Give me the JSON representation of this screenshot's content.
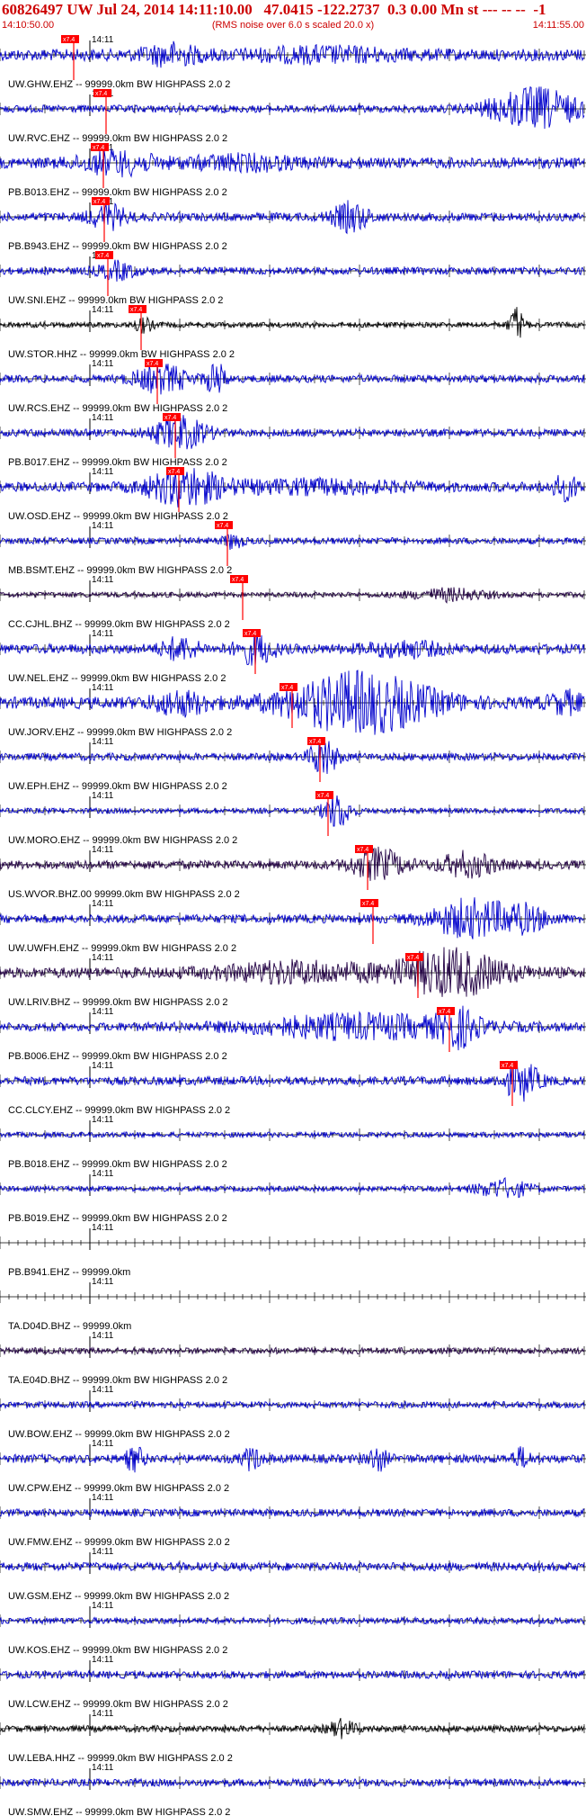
{
  "header": {
    "title": "60826497 UW Jul 24, 2014 14:11:10.00   47.0415 -122.2737  0.3 0.00 Mn st --- -- --  -1",
    "start_time": "14:10:50.00",
    "note": "(RMS noise over 6.0 s scaled 20.0 x)",
    "end_time": "14:11:55.00"
  },
  "colors": {
    "header_text": "#cc0000",
    "trace_blue": "#0000cc",
    "trace_black": "#000000",
    "trace_dark": "#220044",
    "pick": "#ff0000",
    "axis": "#000000"
  },
  "chart_data": {
    "type": "seismogram",
    "time_range_s": [
      0,
      65
    ],
    "tick_label": "14:11",
    "pick_label": "x7.4",
    "traces": [
      {
        "label": "UW.GHW.EHZ -- 99999.0km BW  HIGHPASS  2.0  2",
        "color": "#0000cc",
        "pick_s": 8.2,
        "amp": 0.55,
        "bursts": [
          [
            19,
            3,
            0.8
          ],
          [
            36,
            8,
            0.45
          ]
        ]
      },
      {
        "label": "UW.RVC.EHZ -- 99999.0km BW  HIGHPASS  2.0  2",
        "color": "#0000cc",
        "pick_s": 11.8,
        "amp": 0.35,
        "bursts": [
          [
            59.5,
            5,
            1.8
          ]
        ]
      },
      {
        "label": "PB.B013.EHZ -- 99999.0km BW  HIGHPASS  2.0  2",
        "color": "#0000cc",
        "pick_s": 11.5,
        "amp": 0.5,
        "bursts": [
          [
            13,
            4,
            0.9
          ],
          [
            27,
            6,
            0.5
          ]
        ]
      },
      {
        "label": "PB.B943.EHZ -- 99999.0km BW  HIGHPASS  2.0  2",
        "color": "#0000cc",
        "pick_s": 11.6,
        "amp": 0.4,
        "bursts": [
          [
            12,
            2,
            1.0
          ],
          [
            39,
            2,
            1.2
          ]
        ]
      },
      {
        "label": "UW.SNI.EHZ -- 99999.0km BW  HIGHPASS  2.0  2",
        "color": "#0000cc",
        "pick_s": 12.0,
        "amp": 0.35,
        "bursts": [
          [
            13,
            2,
            0.7
          ]
        ]
      },
      {
        "label": "UW.STOR.HHZ -- 99999.0km BW  HIGHPASS  2.0  2",
        "color": "#000000",
        "pick_s": 15.7,
        "amp": 0.25,
        "bursts": [
          [
            16,
            1,
            0.6
          ],
          [
            57.5,
            0.8,
            1.6
          ]
        ]
      },
      {
        "label": "UW.RCS.EHZ -- 99999.0km BW  HIGHPASS  2.0  2",
        "color": "#0000cc",
        "pick_s": 17.5,
        "amp": 0.35,
        "bursts": [
          [
            18,
            3,
            1.2
          ],
          [
            24,
            1,
            1.5
          ]
        ]
      },
      {
        "label": "PB.B017.EHZ -- 99999.0km BW  HIGHPASS  2.0  2",
        "color": "#0000cc",
        "pick_s": 19.5,
        "amp": 0.35,
        "bursts": [
          [
            20,
            3,
            1.4
          ]
        ]
      },
      {
        "label": "UW.OSD.EHZ -- 99999.0km BW  HIGHPASS  2.0  2",
        "color": "#0000cc",
        "pick_s": 19.9,
        "amp": 0.45,
        "bursts": [
          [
            20.5,
            4,
            1.6
          ],
          [
            35,
            10,
            0.45
          ],
          [
            63,
            1.5,
            1.0
          ]
        ]
      },
      {
        "label": "MB.BSMT.EHZ -- 99999.0km BW  HIGHPASS  2.0  2",
        "color": "#0000cc",
        "pick_s": 25.3,
        "amp": 0.3,
        "bursts": [
          [
            26,
            1,
            0.7
          ]
        ]
      },
      {
        "label": "CC.CJHL.BHZ -- 99999.0km BW  HIGHPASS  2.0  2",
        "color": "#220044",
        "pick_s": 27.0,
        "amp": 0.25,
        "bursts": [
          [
            50,
            4,
            0.5
          ]
        ]
      },
      {
        "label": "UW.NEL.EHZ -- 99999.0km BW  HIGHPASS  2.0  2",
        "color": "#0000cc",
        "pick_s": 28.4,
        "amp": 0.45,
        "bursts": [
          [
            28.5,
            2,
            1.3
          ],
          [
            20,
            2,
            0.9
          ],
          [
            45,
            4,
            0.6
          ]
        ]
      },
      {
        "label": "UW.JORV.EHZ -- 99999.0km BW  HIGHPASS  2.0  2",
        "color": "#0000cc",
        "pick_s": 32.5,
        "amp": 0.55,
        "bursts": [
          [
            40,
            8,
            2.6
          ],
          [
            20,
            3,
            0.9
          ],
          [
            63,
            2,
            0.8
          ]
        ]
      },
      {
        "label": "UW.EPH.EHZ -- 99999.0km BW  HIGHPASS  2.0  2",
        "color": "#0000cc",
        "pick_s": 35.6,
        "amp": 0.35,
        "bursts": [
          [
            36,
            1.5,
            1.6
          ]
        ]
      },
      {
        "label": "UW.MORO.EHZ -- 99999.0km BW  HIGHPASS  2.0  2",
        "color": "#0000cc",
        "pick_s": 36.5,
        "amp": 0.25,
        "bursts": [
          [
            37.5,
            1.5,
            1.6
          ]
        ]
      },
      {
        "label": "US.WVOR.BHZ.00 99999.0km BW  HIGHPASS  2.0  2",
        "color": "#220044",
        "pick_s": 40.9,
        "amp": 0.4,
        "bursts": [
          [
            42,
            3,
            1.3
          ],
          [
            52,
            3,
            1.0
          ]
        ]
      },
      {
        "label": "UW.UWFH.EHZ -- 99999.0km BW  HIGHPASS  2.0  2",
        "color": "#0000cc",
        "pick_s": 41.5,
        "amp": 0.4,
        "bursts": [
          [
            52,
            4,
            1.6
          ],
          [
            58,
            3,
            1.1
          ]
        ]
      },
      {
        "label": "UW.LRIV.BHZ -- 99999.0km BW  HIGHPASS  2.0  2",
        "color": "#220044",
        "pick_s": 46.5,
        "amp": 0.5,
        "bursts": [
          [
            50,
            6,
            2.0
          ],
          [
            33,
            8,
            0.8
          ]
        ]
      },
      {
        "label": "PB.B006.EHZ -- 99999.0km BW  HIGHPASS  2.0  2",
        "color": "#0000cc",
        "pick_s": 50.0,
        "amp": 0.4,
        "bursts": [
          [
            40,
            12,
            1.0
          ],
          [
            51,
            2,
            1.4
          ]
        ]
      },
      {
        "label": "CC.CLCY.EHZ -- 99999.0km BW  HIGHPASS  2.0  2",
        "color": "#0000cc",
        "pick_s": 57.0,
        "amp": 0.4,
        "bursts": [
          [
            58,
            2,
            1.6
          ]
        ]
      },
      {
        "label": "PB.B018.EHZ -- 99999.0km BW  HIGHPASS  2.0  2",
        "color": "#0000cc",
        "pick_s": null,
        "amp": 0.25,
        "bursts": []
      },
      {
        "label": "PB.B019.EHZ -- 99999.0km BW  HIGHPASS  2.0  2",
        "color": "#0000cc",
        "pick_s": null,
        "amp": 0.25,
        "bursts": [
          [
            56,
            3,
            0.8
          ]
        ]
      },
      {
        "label": "PB.B941.EHZ -- 99999.0km",
        "color": "#0000cc",
        "pick_s": null,
        "amp": 0.0,
        "bursts": []
      },
      {
        "label": "TA.D04D.BHZ -- 99999.0km",
        "color": "#0000cc",
        "pick_s": null,
        "amp": 0.0,
        "bursts": []
      },
      {
        "label": "TA.E04D.BHZ -- 99999.0km BW  HIGHPASS  2.0  2",
        "color": "#220044",
        "pick_s": null,
        "amp": 0.3,
        "bursts": []
      },
      {
        "label": "UW.BOW.EHZ -- 99999.0km BW  HIGHPASS  2.0  2",
        "color": "#0000cc",
        "pick_s": null,
        "amp": 0.3,
        "bursts": []
      },
      {
        "label": "UW.CPW.EHZ -- 99999.0km BW  HIGHPASS  2.0  2",
        "color": "#0000cc",
        "pick_s": null,
        "amp": 0.4,
        "bursts": [
          [
            15,
            1,
            1.0
          ],
          [
            28,
            1,
            0.9
          ],
          [
            42,
            1,
            1.0
          ],
          [
            58,
            1,
            0.8
          ]
        ]
      },
      {
        "label": "UW.FMW.EHZ -- 99999.0km BW  HIGHPASS  2.0  2",
        "color": "#0000cc",
        "pick_s": null,
        "amp": 0.35,
        "bursts": []
      },
      {
        "label": "UW.GSM.EHZ -- 99999.0km BW  HIGHPASS  2.0  2",
        "color": "#0000cc",
        "pick_s": null,
        "amp": 0.4,
        "bursts": []
      },
      {
        "label": "UW.KOS.EHZ -- 99999.0km BW  HIGHPASS  2.0  2",
        "color": "#0000cc",
        "pick_s": null,
        "amp": 0.3,
        "bursts": []
      },
      {
        "label": "UW.LCW.EHZ -- 99999.0km BW  HIGHPASS  2.0  2",
        "color": "#0000cc",
        "pick_s": null,
        "amp": 0.35,
        "bursts": []
      },
      {
        "label": "UW.LEBA.HHZ -- 99999.0km BW  HIGHPASS  2.0  2",
        "color": "#000000",
        "pick_s": null,
        "amp": 0.3,
        "bursts": [
          [
            38,
            1.5,
            0.7
          ]
        ]
      },
      {
        "label": "UW.SMW.EHZ -- 99999.0km BW  HIGHPASS  2.0  2",
        "color": "#0000cc",
        "pick_s": null,
        "amp": 0.35,
        "bursts": []
      }
    ]
  }
}
